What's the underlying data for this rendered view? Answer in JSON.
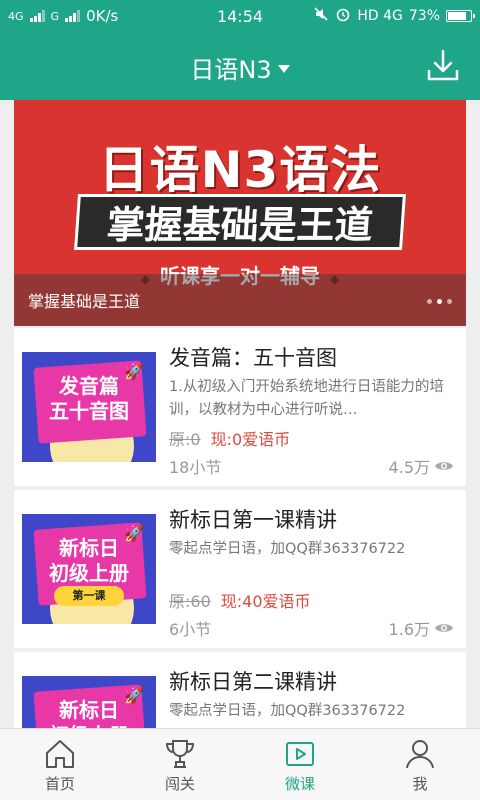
{
  "status_bar": {
    "left_network_1": "4G",
    "left_network_2": "G",
    "speed": "0K/s",
    "time": "14:54",
    "right_network": "HD 4G",
    "battery": "73%",
    "battery_level": 0.73
  },
  "navbar": {
    "title": "日语N3",
    "download_icon": "download-icon"
  },
  "banner": {
    "title": "日语N3语法",
    "subtitle": "掌握基础是王道",
    "tagline": "听课享一对一辅导",
    "caption": "掌握基础是王道",
    "dots": 3,
    "active_dot": 1
  },
  "courses": [
    {
      "title": "发音篇：五十音图",
      "desc": "1.从初级入门开始系统地进行日语能力的培训，以教材为中心进行听说…",
      "price_original": "原:0",
      "price_now": "现:0爱语币",
      "sessions": "18小节",
      "views": "4.5万",
      "thumb_text": "发音篇\n五十音图",
      "thumb_badge": ""
    },
    {
      "title": "新标日第一课精讲",
      "desc": "零起点学日语，加QQ群363376722",
      "price_original": "原:60",
      "price_now": "现:40爱语币",
      "sessions": "6小节",
      "views": "1.6万",
      "thumb_text": "新标日\n初级上册",
      "thumb_badge": "第一课"
    },
    {
      "title": "新标日第二课精讲",
      "desc": "零起点学日语，加QQ群363376722",
      "price_original": "",
      "price_now": "",
      "sessions": "",
      "views": "",
      "thumb_text": "新标日\n初级上册",
      "thumb_badge": ""
    }
  ],
  "tabbar": {
    "tabs": [
      {
        "label": "首页",
        "icon": "home-icon"
      },
      {
        "label": "闯关",
        "icon": "trophy-icon"
      },
      {
        "label": "微课",
        "icon": "play-video-icon",
        "active": true
      },
      {
        "label": "我",
        "icon": "user-icon"
      }
    ]
  },
  "colors": {
    "primary": "#1fa689",
    "price_red": "#e04a3a",
    "banner_red": "#d9342f"
  }
}
